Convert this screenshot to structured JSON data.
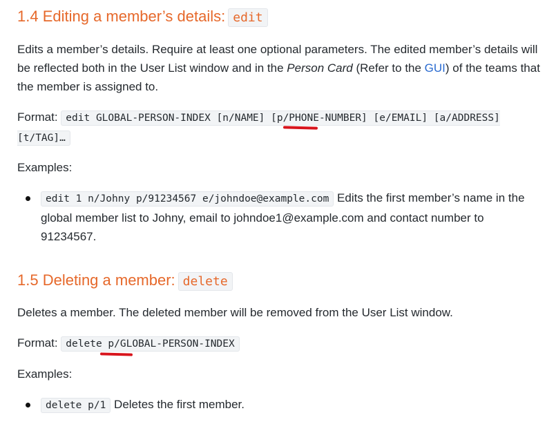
{
  "section_edit": {
    "title": "1.4 Editing a member’s details:",
    "title_code": "edit",
    "desc_part1": "Edits a member’s details. Require at least one optional parameters. The edited member’s details will be reflected both in the User List window and in the ",
    "desc_italic": "Person Card",
    "desc_part2": " (Refer to the ",
    "desc_link": "GUI",
    "desc_part3": ") of the teams that the member is assigned to.",
    "format_label": "Format:",
    "format_code": "edit GLOBAL-PERSON-INDEX [n/NAME] [p/PHONE-NUMBER] [e/EMAIL] [a/ADDRESS] [t/TAG]…",
    "examples_label": "Examples:",
    "example_code": "edit 1 n/Johny p/91234567 e/johndoe@example.com",
    "example_text": " Edits the first member’s name in the global member list to Johny, email to johndoe1@example.com and contact number to 91234567."
  },
  "section_delete": {
    "title": "1.5 Deleting a member:",
    "title_code": "delete",
    "desc": "Deletes a member. The deleted member will be removed from the User List window.",
    "format_label": "Format:",
    "format_code": "delete p/GLOBAL-PERSON-INDEX",
    "examples_label": "Examples:",
    "example_code": "delete p/1",
    "example_text": " Deletes the first member."
  },
  "colors": {
    "heading": "#e6682a",
    "annotation": "#d8141c",
    "link": "#2a6bd0"
  }
}
